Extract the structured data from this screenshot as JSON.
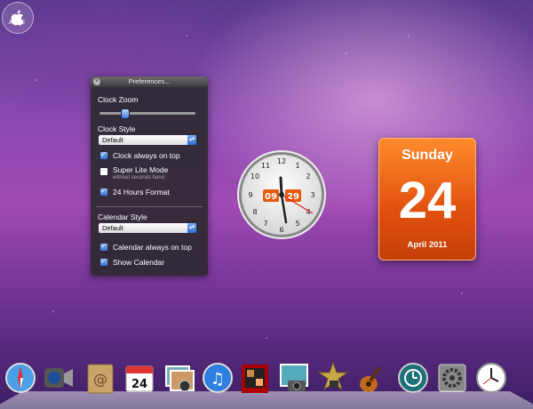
{
  "badge": {
    "text": "APPLE"
  },
  "prefs": {
    "title": "Preferences...",
    "clock_zoom_label": "Clock Zoom",
    "clock_zoom_value": 0.3,
    "clock_style_label": "Clock Style",
    "clock_style_value": "Default",
    "clock_on_top": {
      "label": "Clock always on top",
      "checked": true
    },
    "super_lite": {
      "label": "Super Lite Mode",
      "sub": "without seconds hand",
      "checked": false
    },
    "hours24": {
      "label": "24 Hours Format",
      "checked": true
    },
    "calendar_style_label": "Calendar Style",
    "calendar_style_value": "Default",
    "calendar_on_top": {
      "label": "Calendar always on top",
      "checked": true
    },
    "show_calendar": {
      "label": "Show Calendar",
      "checked": true
    }
  },
  "clock": {
    "hour_digits": "09",
    "minute_digits": "29"
  },
  "calendar": {
    "day": "Sunday",
    "date": "24",
    "month": "April 2011"
  },
  "dock": {
    "items": [
      {
        "icon": "safari-icon"
      },
      {
        "icon": "facetime-icon"
      },
      {
        "icon": "address-book-icon"
      },
      {
        "icon": "ical-icon",
        "text": "24"
      },
      {
        "icon": "preview-icon"
      },
      {
        "icon": "itunes-icon"
      },
      {
        "icon": "photo-booth-icon"
      },
      {
        "icon": "iphoto-icon"
      },
      {
        "icon": "imovie-icon"
      },
      {
        "icon": "garageband-icon"
      },
      {
        "icon": "time-machine-icon"
      },
      {
        "icon": "system-preferences-icon"
      },
      {
        "icon": "clock-app-icon"
      }
    ]
  }
}
